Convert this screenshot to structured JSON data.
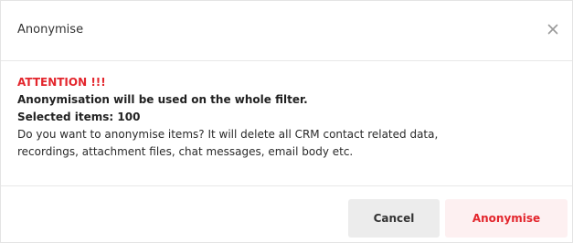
{
  "dialog": {
    "title": "Anonymise",
    "close_icon": "close-icon",
    "attention": "ATTENTION !!!",
    "scope_line": "Anonymisation will be used on the whole filter.",
    "selected_items": "Selected items: 100",
    "description_line1": "Do you want to anonymise items? It will delete all CRM contact related data,",
    "description_line2": "recordings, attachment files, chat messages, email body etc.",
    "buttons": {
      "cancel": "Cancel",
      "confirm": "Anonymise"
    },
    "colors": {
      "attention": "#e3262d",
      "confirm_bg": "#fdf0f1",
      "cancel_bg": "#ececec"
    }
  }
}
